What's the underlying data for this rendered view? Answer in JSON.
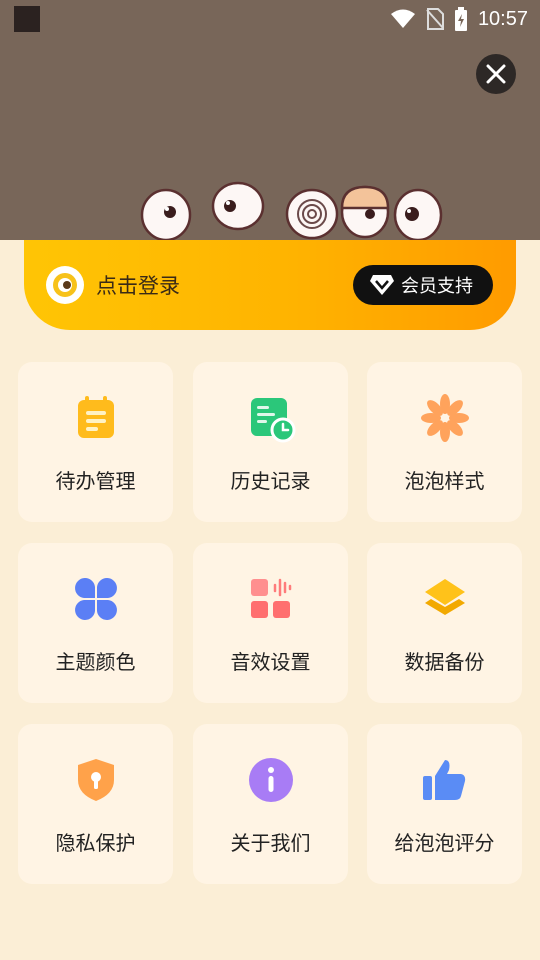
{
  "status_bar": {
    "time": "10:57"
  },
  "login": {
    "prompt": "点击登录",
    "vip_label": "会员支持"
  },
  "menu": {
    "items": [
      {
        "label": "待办管理",
        "icon": "notepad-icon"
      },
      {
        "label": "历史记录",
        "icon": "history-icon"
      },
      {
        "label": "泡泡样式",
        "icon": "flower-icon"
      },
      {
        "label": "主题颜色",
        "icon": "clover-icon"
      },
      {
        "label": "音效设置",
        "icon": "sound-icon"
      },
      {
        "label": "数据备份",
        "icon": "layers-icon"
      },
      {
        "label": "隐私保护",
        "icon": "shield-lock-icon"
      },
      {
        "label": "关于我们",
        "icon": "info-icon"
      },
      {
        "label": "给泡泡评分",
        "icon": "thumbs-up-icon"
      }
    ]
  },
  "colors": {
    "header_bg": "#786659",
    "page_bg": "#fbeed6",
    "tile_bg": "#fff4e4",
    "accent_gradient_start": "#ffc505",
    "accent_gradient_end": "#ff9b00"
  }
}
